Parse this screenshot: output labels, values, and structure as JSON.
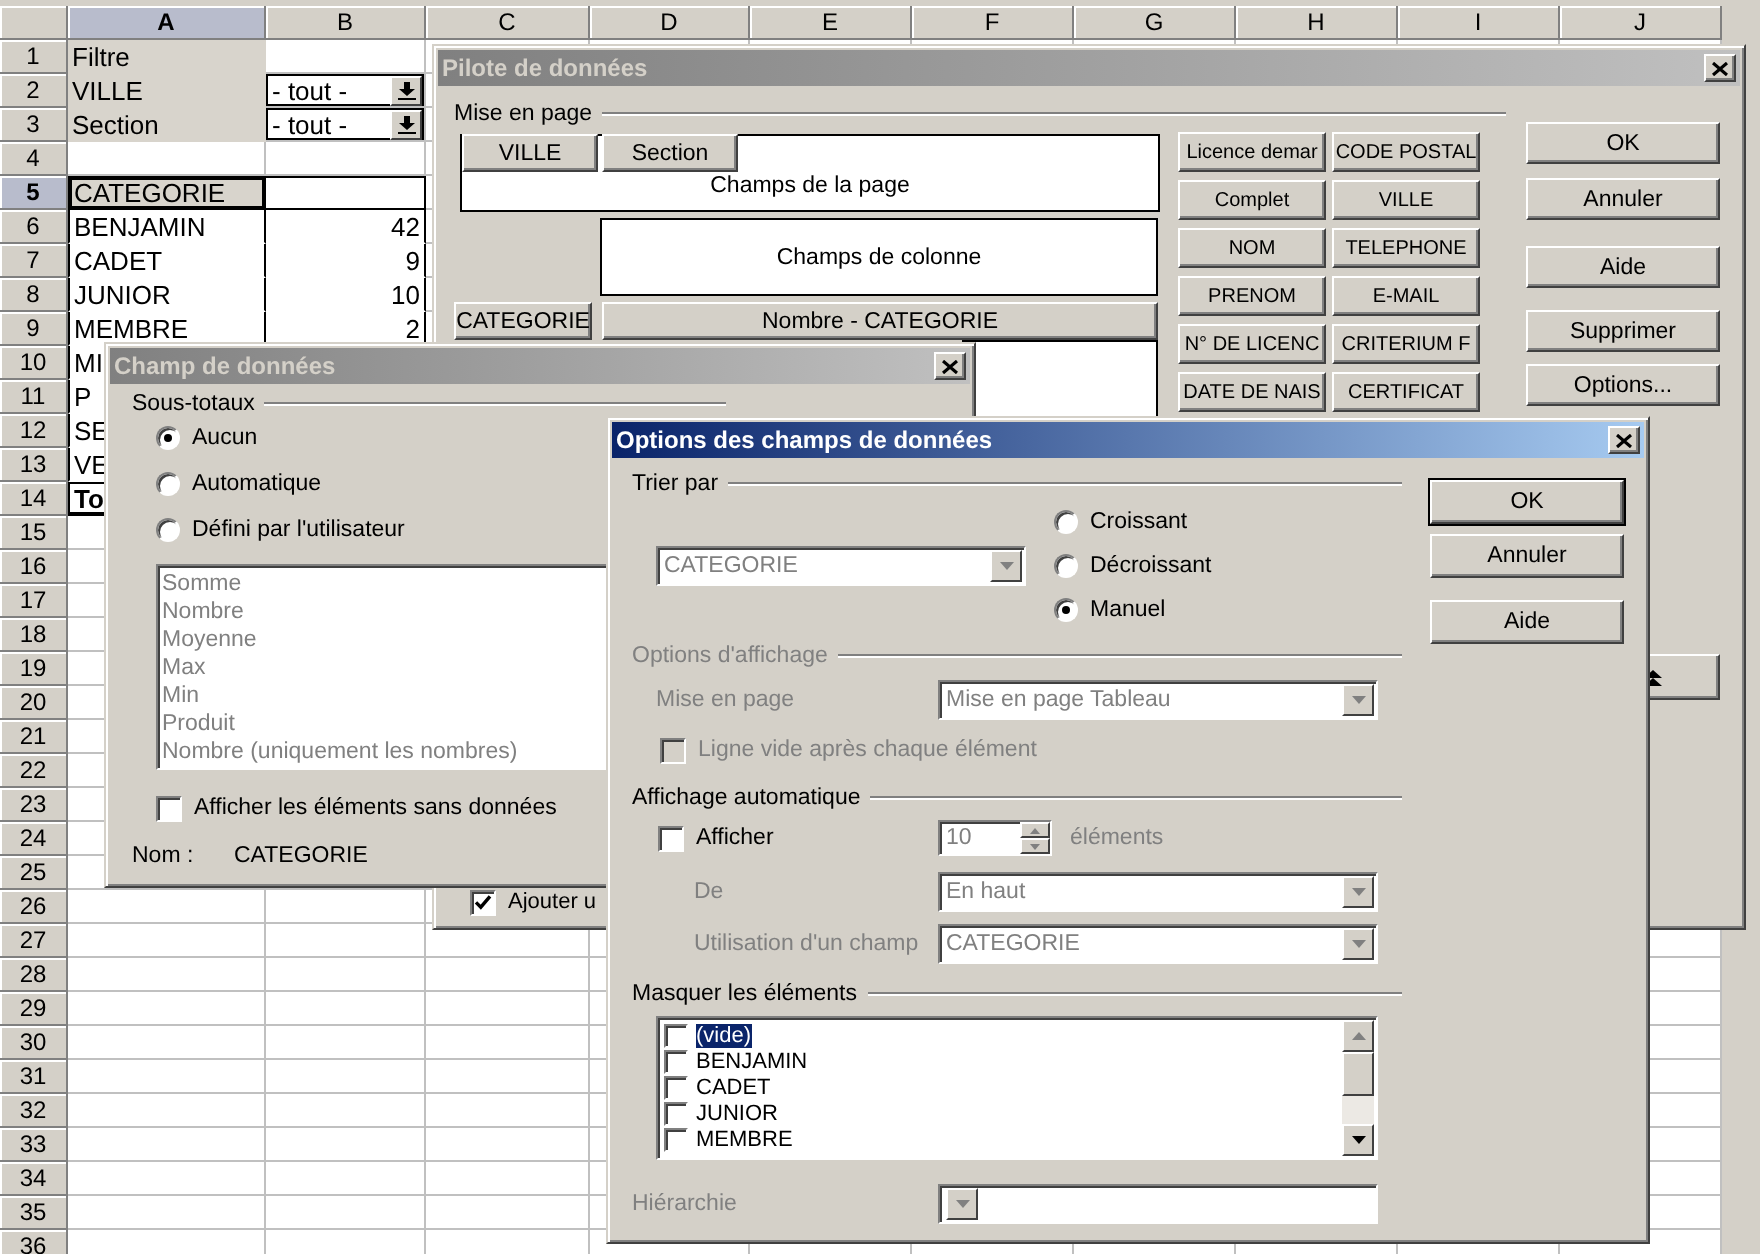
{
  "spreadsheet": {
    "columns": [
      {
        "label": "A",
        "selected": true
      },
      {
        "label": "B",
        "selected": false
      },
      {
        "label": "C",
        "selected": false
      },
      {
        "label": "D",
        "selected": false
      },
      {
        "label": "E",
        "selected": false
      },
      {
        "label": "F",
        "selected": false
      },
      {
        "label": "G",
        "selected": false
      },
      {
        "label": "H",
        "selected": false
      },
      {
        "label": "I",
        "selected": false
      },
      {
        "label": "J",
        "selected": false
      }
    ],
    "rows": [
      {
        "number": "1",
        "selected": false,
        "cells": [
          {
            "kind": "filter",
            "text": "Filtre"
          }
        ]
      },
      {
        "number": "2",
        "selected": false,
        "cells": [
          {
            "kind": "filter",
            "text": "VILLE"
          },
          {
            "kind": "select",
            "text": "- tout -"
          }
        ]
      },
      {
        "number": "3",
        "selected": false,
        "cells": [
          {
            "kind": "filter",
            "text": "Section"
          },
          {
            "kind": "select",
            "text": "- tout -"
          }
        ]
      },
      {
        "number": "4",
        "selected": false
      },
      {
        "number": "5",
        "selected": true,
        "cells": [
          {
            "kind": "header",
            "text": "CATEGORIE"
          },
          {
            "kind": "pivot-header"
          }
        ]
      },
      {
        "number": "6",
        "selected": false,
        "cells": [
          {
            "kind": "item",
            "text": "BENJAMIN"
          },
          {
            "kind": "number",
            "text": "42"
          }
        ]
      },
      {
        "number": "7",
        "selected": false,
        "cells": [
          {
            "kind": "item",
            "text": "CADET"
          },
          {
            "kind": "number",
            "text": "9"
          }
        ]
      },
      {
        "number": "8",
        "selected": false,
        "cells": [
          {
            "kind": "item",
            "text": "JUNIOR"
          },
          {
            "kind": "number",
            "text": "10"
          }
        ]
      },
      {
        "number": "9",
        "selected": false,
        "cells": [
          {
            "kind": "item",
            "text": "MEMBRE"
          },
          {
            "kind": "number",
            "text": "2"
          }
        ]
      },
      {
        "number": "10",
        "selected": false,
        "cells": [
          {
            "kind": "item",
            "text": "MI"
          }
        ]
      },
      {
        "number": "11",
        "selected": false,
        "cells": [
          {
            "kind": "item",
            "text": "P"
          }
        ]
      },
      {
        "number": "12",
        "selected": false,
        "cells": [
          {
            "kind": "item",
            "text": "SE"
          }
        ]
      },
      {
        "number": "13",
        "selected": false,
        "cells": [
          {
            "kind": "item",
            "text": "VE"
          }
        ]
      },
      {
        "number": "14",
        "selected": false,
        "cells": [
          {
            "kind": "total",
            "text": "To"
          }
        ]
      },
      {
        "number": "15",
        "selected": false
      },
      {
        "number": "16",
        "selected": false
      },
      {
        "number": "17",
        "selected": false
      },
      {
        "number": "18",
        "selected": false
      },
      {
        "number": "19",
        "selected": false
      },
      {
        "number": "20",
        "selected": false
      },
      {
        "number": "21",
        "selected": false
      },
      {
        "number": "22",
        "selected": false
      },
      {
        "number": "23",
        "selected": false
      },
      {
        "number": "24",
        "selected": false
      },
      {
        "number": "25",
        "selected": false
      },
      {
        "number": "26",
        "selected": false
      },
      {
        "number": "27",
        "selected": false
      },
      {
        "number": "28",
        "selected": false
      },
      {
        "number": "29",
        "selected": false
      },
      {
        "number": "30",
        "selected": false
      },
      {
        "number": "31",
        "selected": false
      },
      {
        "number": "32",
        "selected": false
      },
      {
        "number": "33",
        "selected": false
      },
      {
        "number": "34",
        "selected": false
      },
      {
        "number": "35",
        "selected": false
      },
      {
        "number": "36",
        "selected": false
      }
    ]
  },
  "pilot_dialog": {
    "title": "Pilote de données",
    "active": false,
    "layout_label": "Mise en page",
    "page_fields": [
      "VILLE",
      "Section"
    ],
    "page_area": "Champs de la page",
    "column_area": "Champs de colonne",
    "row_fields": [
      "CATEGORIE"
    ],
    "data_fields": [
      "Nombre - CATEGORIE"
    ],
    "fields": [
      "Licence demar",
      "CODE POSTAL",
      "Complet",
      "VILLE",
      "NOM",
      "TELEPHONE",
      "PRENOM",
      "E-MAIL",
      "N° DE LICENC",
      "CRITERIUM F",
      "DATE DE NAIS",
      "CERTIFICAT"
    ],
    "buttons": [
      "OK",
      "Annuler",
      "Aide",
      "Supprimer",
      "Options..."
    ],
    "add_option": {
      "label": "Ajouter u",
      "checked": true
    }
  },
  "champ_dialog": {
    "title": "Champ de données",
    "active": false,
    "subtotals_label": "Sous-totaux",
    "subtotals": [
      {
        "label": "Aucun",
        "selected": true
      },
      {
        "label": "Automatique",
        "selected": false
      },
      {
        "label": "Défini par l'utilisateur",
        "selected": false
      }
    ],
    "functions": {
      "disabled": true,
      "items": [
        "Somme",
        "Nombre",
        "Moyenne",
        "Max",
        "Min",
        "Produit",
        "Nombre (uniquement les nombres)"
      ]
    },
    "show_empty": {
      "label": "Afficher les éléments sans données",
      "checked": false
    },
    "name_label": "Nom :",
    "name_value": "CATEGORIE"
  },
  "options_dialog": {
    "title": "Options des champs de données",
    "active": true,
    "sort_label": "Trier par",
    "sort_field": {
      "value": "CATEGORIE",
      "disabled": true
    },
    "sort_orders": [
      {
        "label": "Croissant",
        "selected": false
      },
      {
        "label": "Décroissant",
        "selected": false
      },
      {
        "label": "Manuel",
        "selected": true
      }
    ],
    "buttons": [
      "OK",
      "Annuler",
      "Aide"
    ],
    "display": {
      "label": "Options d'affichage",
      "disabled": true,
      "layout_label": "Mise en page",
      "layout_value": "Mise en page Tableau",
      "empty_line": {
        "label": "Ligne vide après chaque élément",
        "checked": false
      }
    },
    "auto": {
      "label": "Affichage automatique",
      "show": {
        "label": "Afficher",
        "checked": false
      },
      "disabled": true,
      "count": "10",
      "count_unit": "éléments",
      "from_label": "De",
      "from_value": "En haut",
      "using_label": "Utilisation d'un champ",
      "using_value": "CATEGORIE"
    },
    "hide": {
      "label": "Masquer les éléments",
      "items": [
        {
          "label": "(vide)",
          "checked": false,
          "selected": true
        },
        {
          "label": "BENJAMIN",
          "checked": false,
          "selected": false
        },
        {
          "label": "CADET",
          "checked": false,
          "selected": false
        },
        {
          "label": "JUNIOR",
          "checked": false,
          "selected": false
        },
        {
          "label": "MEMBRE",
          "checked": false,
          "selected": false
        }
      ]
    },
    "hierarchy": {
      "label": "Hiérarchie",
      "disabled": true
    }
  }
}
